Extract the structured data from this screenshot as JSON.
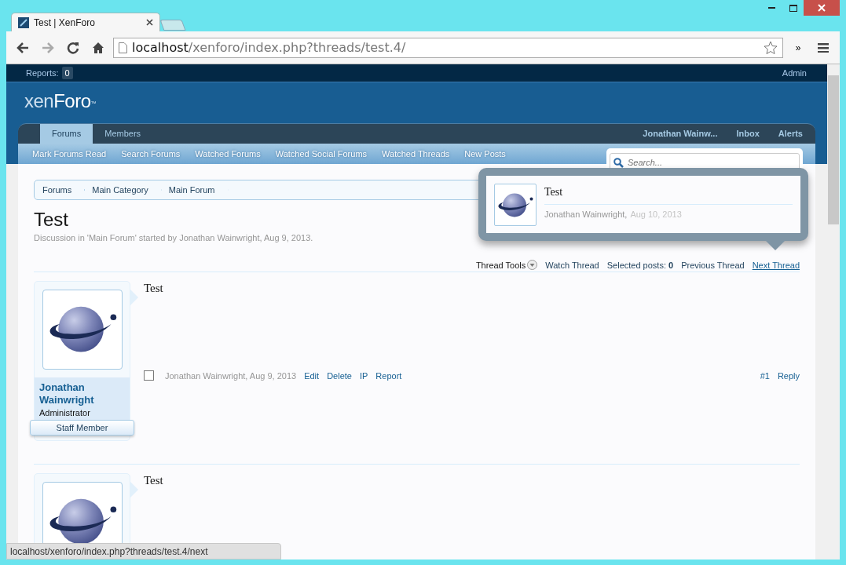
{
  "browser": {
    "tab_title": "Test | XenForo",
    "url_host": "localhost",
    "url_path": "/xenforo/index.php?threads/test.4/",
    "overflow_button": "»",
    "status_url": "localhost/xenforo/index.php?threads/test.4/next"
  },
  "top_bar": {
    "reports_label": "Reports:",
    "reports_count": "0",
    "admin_link": "Admin"
  },
  "logo": {
    "light": "xen",
    "bold": "Foro",
    "mark": "™"
  },
  "nav_tabs": [
    {
      "label": "Forums",
      "selected": true
    },
    {
      "label": "Members",
      "selected": false
    }
  ],
  "account_links": [
    "Jonathan Wainw...",
    "Inbox",
    "Alerts"
  ],
  "sub_nav": [
    "Mark Forums Read",
    "Search Forums",
    "Watched Forums",
    "Watched Social Forums",
    "Watched Threads",
    "New Posts"
  ],
  "search": {
    "placeholder": "Search..."
  },
  "breadcrumbs": [
    "Forums",
    "Main Category",
    "Main Forum"
  ],
  "thread": {
    "title": "Test",
    "description": "Discussion in 'Main Forum' started by Jonathan Wainwright, Aug 9, 2013."
  },
  "thread_tools": [
    {
      "label": "Thread Tools",
      "kind": "menu",
      "hovered": false
    },
    {
      "label": "Watch Thread",
      "kind": "link",
      "hovered": false
    },
    {
      "label": "Selected posts: **0**",
      "kind": "link",
      "hovered": false
    },
    {
      "label": "Previous Thread",
      "kind": "link",
      "hovered": false
    },
    {
      "label": "Next Thread",
      "kind": "link",
      "hovered": true
    }
  ],
  "posts": [
    {
      "author": "Jonathan Wainwright",
      "role": "Administrator",
      "banner": "Staff Member",
      "message": "Test",
      "checked": false,
      "byline": "Jonathan Wainwright, Aug 9, 2013",
      "actions": [
        "Edit",
        "Delete",
        "IP",
        "Report"
      ],
      "number": "#1",
      "reply": "Reply"
    },
    {
      "message": "Test"
    }
  ],
  "preview_popup": {
    "title": "Test",
    "author": "Jonathan Wainwright,",
    "date": "Aug 10, 2013"
  }
}
